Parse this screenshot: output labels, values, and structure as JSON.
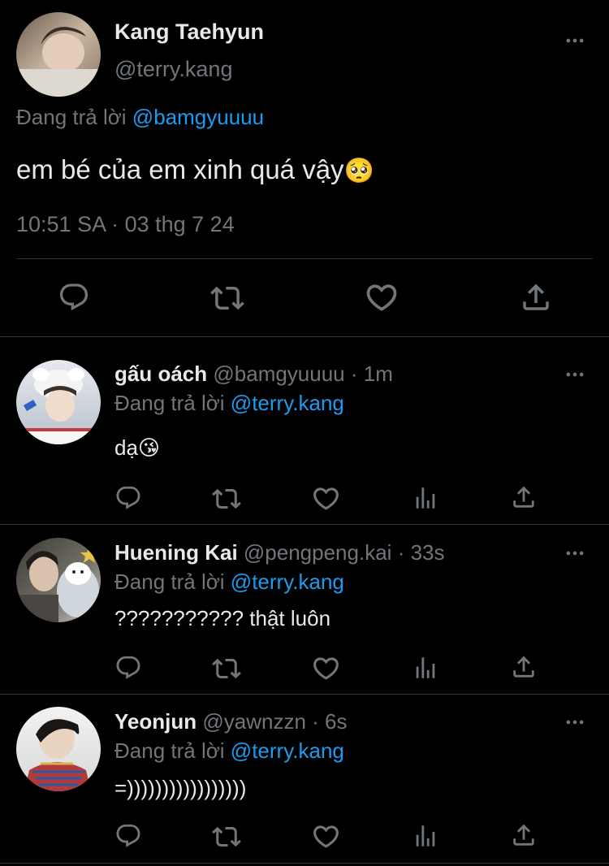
{
  "main_tweet": {
    "display_name": "Kang Taehyun",
    "handle": "@terry.kang",
    "replying_prefix": "Đang trả lời",
    "replying_to": "@bamgyuuuu",
    "text": "em bé của em xinh quá vậy",
    "emoji": "🥺",
    "timestamp": "10:51 SA · 03 thg 7 24"
  },
  "replies": [
    {
      "display_name": "gấu oách",
      "handle": "@bamgyuuuu",
      "time": "· 1m",
      "replying_prefix": "Đang trả lời",
      "replying_to": "@terry.kang",
      "text": "dạ",
      "emoji": "😘"
    },
    {
      "display_name": "Huening Kai",
      "handle": "@pengpeng.kai",
      "time": "· 33s",
      "replying_prefix": "Đang trả lời",
      "replying_to": "@terry.kang",
      "text": "??????????? thật luôn",
      "emoji": ""
    },
    {
      "display_name": "Yeonjun",
      "handle": "@yawnzzn",
      "time": "· 6s",
      "replying_prefix": "Đang trả lời",
      "replying_to": "@terry.kang",
      "text": "=)))))))))))))))))",
      "emoji": ""
    }
  ],
  "icons": {
    "reply": "reply-icon",
    "retweet": "retweet-icon",
    "like": "like-icon",
    "views": "views-icon",
    "share": "share-icon",
    "more": "more-icon"
  },
  "colors": {
    "background": "#000000",
    "text": "#e7e9ea",
    "muted": "#71767b",
    "link": "#1d9bf0",
    "divider": "#2f3336"
  }
}
